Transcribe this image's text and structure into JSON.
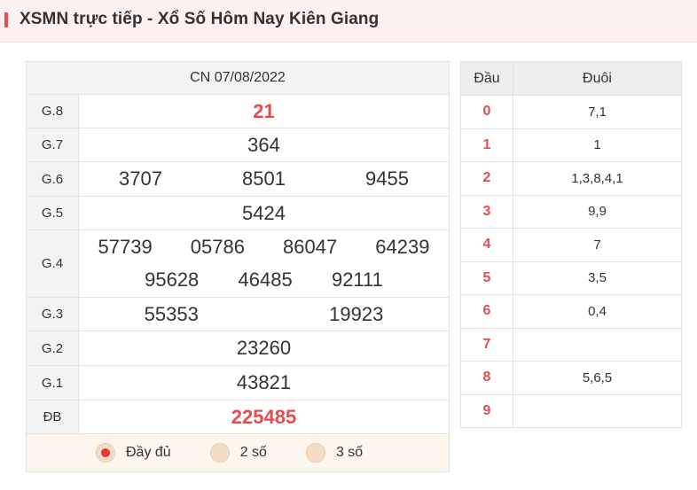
{
  "header": {
    "title": "XSMN trực tiếp - Xổ Số Hôm Nay Kiên Giang"
  },
  "results": {
    "date": "CN 07/08/2022",
    "prizes": [
      {
        "label": "G.8",
        "numbers": [
          "21"
        ]
      },
      {
        "label": "G.7",
        "numbers": [
          "364"
        ]
      },
      {
        "label": "G.6",
        "numbers": [
          "3707",
          "8501",
          "9455"
        ]
      },
      {
        "label": "G.5",
        "numbers": [
          "5424"
        ]
      },
      {
        "label": "G.4",
        "numbers": [
          "57739",
          "05786",
          "86047",
          "64239",
          "95628",
          "46485",
          "92111"
        ]
      },
      {
        "label": "G.3",
        "numbers": [
          "55353",
          "19923"
        ]
      },
      {
        "label": "G.2",
        "numbers": [
          "23260"
        ]
      },
      {
        "label": "G.1",
        "numbers": [
          "43821"
        ]
      },
      {
        "label": "ĐB",
        "numbers": [
          "225485"
        ]
      }
    ],
    "options": [
      {
        "label": "Đầy đủ",
        "selected": true
      },
      {
        "label": "2 số",
        "selected": false
      },
      {
        "label": "3 số",
        "selected": false
      }
    ]
  },
  "loto": {
    "head_label": "Đầu",
    "tail_label": "Đuôi",
    "rows": [
      {
        "head": "0",
        "tail": "7,1"
      },
      {
        "head": "1",
        "tail": "1"
      },
      {
        "head": "2",
        "tail": "1,3,8,4,1"
      },
      {
        "head": "3",
        "tail": "9,9"
      },
      {
        "head": "4",
        "tail": "7"
      },
      {
        "head": "5",
        "tail": "3,5"
      },
      {
        "head": "6",
        "tail": "0,4"
      },
      {
        "head": "7",
        "tail": ""
      },
      {
        "head": "8",
        "tail": "5,6,5"
      },
      {
        "head": "9",
        "tail": ""
      }
    ]
  },
  "colors": {
    "accent": "#e74c4c",
    "header_bg": "#fdf0f0",
    "label_bg": "#f3f3f3",
    "option_bg": "#fdf6ec"
  }
}
